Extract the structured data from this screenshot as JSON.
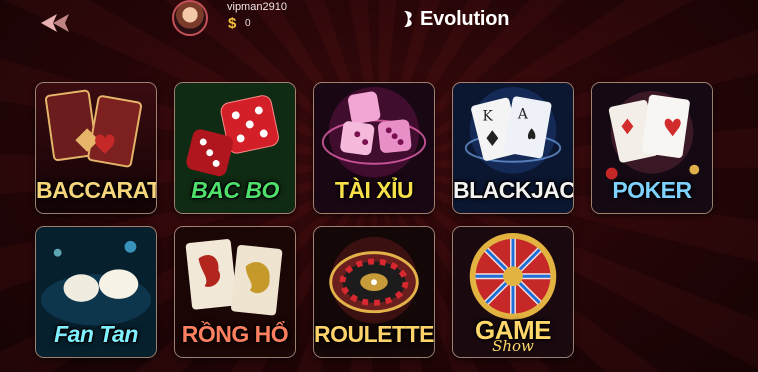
{
  "header": {
    "username": "vipman2910",
    "balance": "0",
    "coin_symbol": "$",
    "provider": "Evolution"
  },
  "games": [
    {
      "id": "baccarat",
      "label": "BACCARAT"
    },
    {
      "id": "bac-bo",
      "label": "BAC BO"
    },
    {
      "id": "tai-xiu",
      "label": "TÀI XỈU"
    },
    {
      "id": "blackjack",
      "label": "BLACKJACK"
    },
    {
      "id": "poker",
      "label": "POKER"
    },
    {
      "id": "fan-tan",
      "label": "Fan Tan"
    },
    {
      "id": "rong-ho",
      "label": "RỒNG HỔ"
    },
    {
      "id": "roulette",
      "label": "ROULETTE"
    },
    {
      "id": "game-show",
      "label": "GAME",
      "sublabel": "Show"
    }
  ],
  "colors": {
    "background": "#240507",
    "accent": "#f3c23c"
  }
}
